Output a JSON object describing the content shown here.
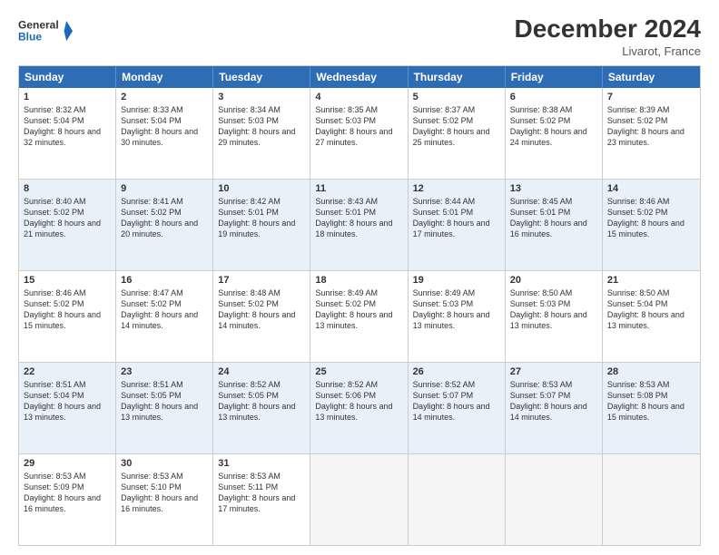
{
  "logo": {
    "line1": "General",
    "line2": "Blue"
  },
  "title": "December 2024",
  "subtitle": "Livarot, France",
  "headers": [
    "Sunday",
    "Monday",
    "Tuesday",
    "Wednesday",
    "Thursday",
    "Friday",
    "Saturday"
  ],
  "weeks": [
    [
      {
        "day": "1",
        "sunrise": "Sunrise: 8:32 AM",
        "sunset": "Sunset: 5:04 PM",
        "daylight": "Daylight: 8 hours and 32 minutes."
      },
      {
        "day": "2",
        "sunrise": "Sunrise: 8:33 AM",
        "sunset": "Sunset: 5:04 PM",
        "daylight": "Daylight: 8 hours and 30 minutes."
      },
      {
        "day": "3",
        "sunrise": "Sunrise: 8:34 AM",
        "sunset": "Sunset: 5:03 PM",
        "daylight": "Daylight: 8 hours and 29 minutes."
      },
      {
        "day": "4",
        "sunrise": "Sunrise: 8:35 AM",
        "sunset": "Sunset: 5:03 PM",
        "daylight": "Daylight: 8 hours and 27 minutes."
      },
      {
        "day": "5",
        "sunrise": "Sunrise: 8:37 AM",
        "sunset": "Sunset: 5:02 PM",
        "daylight": "Daylight: 8 hours and 25 minutes."
      },
      {
        "day": "6",
        "sunrise": "Sunrise: 8:38 AM",
        "sunset": "Sunset: 5:02 PM",
        "daylight": "Daylight: 8 hours and 24 minutes."
      },
      {
        "day": "7",
        "sunrise": "Sunrise: 8:39 AM",
        "sunset": "Sunset: 5:02 PM",
        "daylight": "Daylight: 8 hours and 23 minutes."
      }
    ],
    [
      {
        "day": "8",
        "sunrise": "Sunrise: 8:40 AM",
        "sunset": "Sunset: 5:02 PM",
        "daylight": "Daylight: 8 hours and 21 minutes."
      },
      {
        "day": "9",
        "sunrise": "Sunrise: 8:41 AM",
        "sunset": "Sunset: 5:02 PM",
        "daylight": "Daylight: 8 hours and 20 minutes."
      },
      {
        "day": "10",
        "sunrise": "Sunrise: 8:42 AM",
        "sunset": "Sunset: 5:01 PM",
        "daylight": "Daylight: 8 hours and 19 minutes."
      },
      {
        "day": "11",
        "sunrise": "Sunrise: 8:43 AM",
        "sunset": "Sunset: 5:01 PM",
        "daylight": "Daylight: 8 hours and 18 minutes."
      },
      {
        "day": "12",
        "sunrise": "Sunrise: 8:44 AM",
        "sunset": "Sunset: 5:01 PM",
        "daylight": "Daylight: 8 hours and 17 minutes."
      },
      {
        "day": "13",
        "sunrise": "Sunrise: 8:45 AM",
        "sunset": "Sunset: 5:01 PM",
        "daylight": "Daylight: 8 hours and 16 minutes."
      },
      {
        "day": "14",
        "sunrise": "Sunrise: 8:46 AM",
        "sunset": "Sunset: 5:02 PM",
        "daylight": "Daylight: 8 hours and 15 minutes."
      }
    ],
    [
      {
        "day": "15",
        "sunrise": "Sunrise: 8:46 AM",
        "sunset": "Sunset: 5:02 PM",
        "daylight": "Daylight: 8 hours and 15 minutes."
      },
      {
        "day": "16",
        "sunrise": "Sunrise: 8:47 AM",
        "sunset": "Sunset: 5:02 PM",
        "daylight": "Daylight: 8 hours and 14 minutes."
      },
      {
        "day": "17",
        "sunrise": "Sunrise: 8:48 AM",
        "sunset": "Sunset: 5:02 PM",
        "daylight": "Daylight: 8 hours and 14 minutes."
      },
      {
        "day": "18",
        "sunrise": "Sunrise: 8:49 AM",
        "sunset": "Sunset: 5:02 PM",
        "daylight": "Daylight: 8 hours and 13 minutes."
      },
      {
        "day": "19",
        "sunrise": "Sunrise: 8:49 AM",
        "sunset": "Sunset: 5:03 PM",
        "daylight": "Daylight: 8 hours and 13 minutes."
      },
      {
        "day": "20",
        "sunrise": "Sunrise: 8:50 AM",
        "sunset": "Sunset: 5:03 PM",
        "daylight": "Daylight: 8 hours and 13 minutes."
      },
      {
        "day": "21",
        "sunrise": "Sunrise: 8:50 AM",
        "sunset": "Sunset: 5:04 PM",
        "daylight": "Daylight: 8 hours and 13 minutes."
      }
    ],
    [
      {
        "day": "22",
        "sunrise": "Sunrise: 8:51 AM",
        "sunset": "Sunset: 5:04 PM",
        "daylight": "Daylight: 8 hours and 13 minutes."
      },
      {
        "day": "23",
        "sunrise": "Sunrise: 8:51 AM",
        "sunset": "Sunset: 5:05 PM",
        "daylight": "Daylight: 8 hours and 13 minutes."
      },
      {
        "day": "24",
        "sunrise": "Sunrise: 8:52 AM",
        "sunset": "Sunset: 5:05 PM",
        "daylight": "Daylight: 8 hours and 13 minutes."
      },
      {
        "day": "25",
        "sunrise": "Sunrise: 8:52 AM",
        "sunset": "Sunset: 5:06 PM",
        "daylight": "Daylight: 8 hours and 13 minutes."
      },
      {
        "day": "26",
        "sunrise": "Sunrise: 8:52 AM",
        "sunset": "Sunset: 5:07 PM",
        "daylight": "Daylight: 8 hours and 14 minutes."
      },
      {
        "day": "27",
        "sunrise": "Sunrise: 8:53 AM",
        "sunset": "Sunset: 5:07 PM",
        "daylight": "Daylight: 8 hours and 14 minutes."
      },
      {
        "day": "28",
        "sunrise": "Sunrise: 8:53 AM",
        "sunset": "Sunset: 5:08 PM",
        "daylight": "Daylight: 8 hours and 15 minutes."
      }
    ],
    [
      {
        "day": "29",
        "sunrise": "Sunrise: 8:53 AM",
        "sunset": "Sunset: 5:09 PM",
        "daylight": "Daylight: 8 hours and 16 minutes."
      },
      {
        "day": "30",
        "sunrise": "Sunrise: 8:53 AM",
        "sunset": "Sunset: 5:10 PM",
        "daylight": "Daylight: 8 hours and 16 minutes."
      },
      {
        "day": "31",
        "sunrise": "Sunrise: 8:53 AM",
        "sunset": "Sunset: 5:11 PM",
        "daylight": "Daylight: 8 hours and 17 minutes."
      },
      null,
      null,
      null,
      null
    ]
  ]
}
